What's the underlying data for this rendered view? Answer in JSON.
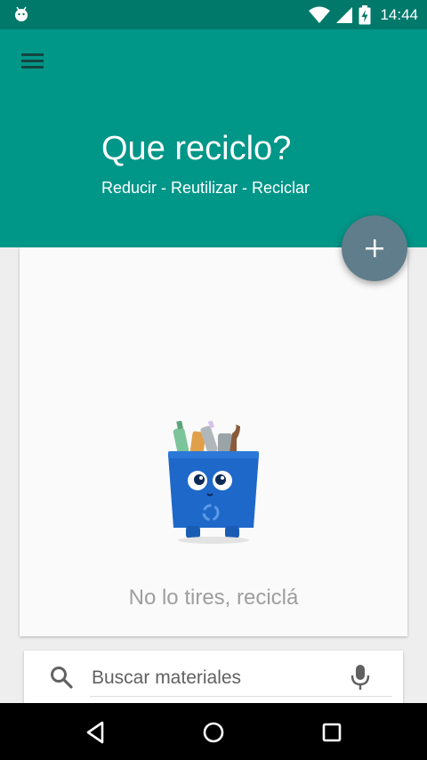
{
  "status_bar": {
    "time": "14:44",
    "icons": [
      "android-notification-icon",
      "wifi-icon",
      "signal-icon",
      "battery-charging-icon"
    ]
  },
  "app_bar": {
    "menu_icon": "hamburger-menu-icon",
    "title": "Que reciclo?",
    "subtitle": "Reducir - Reutilizar - Reciclar",
    "color": "#009688",
    "status_color": "#00796b"
  },
  "fab": {
    "icon": "plus-icon",
    "color": "#607d8b"
  },
  "empty_state": {
    "illustration": "recycle-bin-mascot",
    "message": "No lo tires, reciclá"
  },
  "search": {
    "placeholder": "Buscar materiales",
    "value": "",
    "left_icon": "search-icon",
    "right_icon": "microphone-icon"
  },
  "nav_bar": {
    "buttons": [
      "back-icon",
      "home-icon",
      "recents-icon"
    ]
  }
}
